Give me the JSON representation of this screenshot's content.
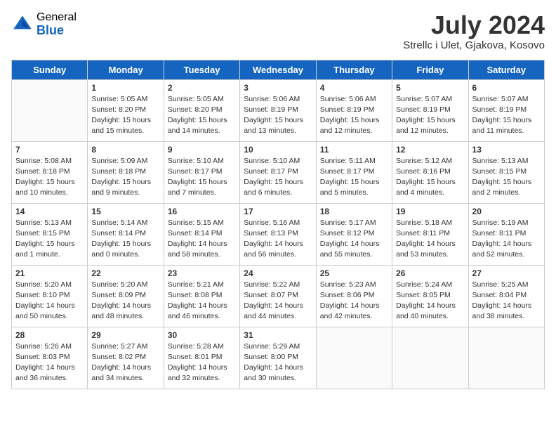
{
  "header": {
    "logo_general": "General",
    "logo_blue": "Blue",
    "month_year": "July 2024",
    "location": "Strellc i Ulet, Gjakova, Kosovo"
  },
  "weekdays": [
    "Sunday",
    "Monday",
    "Tuesday",
    "Wednesday",
    "Thursday",
    "Friday",
    "Saturday"
  ],
  "weeks": [
    [
      {
        "day": "",
        "info": ""
      },
      {
        "day": "1",
        "info": "Sunrise: 5:05 AM\nSunset: 8:20 PM\nDaylight: 15 hours\nand 15 minutes."
      },
      {
        "day": "2",
        "info": "Sunrise: 5:05 AM\nSunset: 8:20 PM\nDaylight: 15 hours\nand 14 minutes."
      },
      {
        "day": "3",
        "info": "Sunrise: 5:06 AM\nSunset: 8:19 PM\nDaylight: 15 hours\nand 13 minutes."
      },
      {
        "day": "4",
        "info": "Sunrise: 5:06 AM\nSunset: 8:19 PM\nDaylight: 15 hours\nand 12 minutes."
      },
      {
        "day": "5",
        "info": "Sunrise: 5:07 AM\nSunset: 8:19 PM\nDaylight: 15 hours\nand 12 minutes."
      },
      {
        "day": "6",
        "info": "Sunrise: 5:07 AM\nSunset: 8:19 PM\nDaylight: 15 hours\nand 11 minutes."
      }
    ],
    [
      {
        "day": "7",
        "info": "Sunrise: 5:08 AM\nSunset: 8:18 PM\nDaylight: 15 hours\nand 10 minutes."
      },
      {
        "day": "8",
        "info": "Sunrise: 5:09 AM\nSunset: 8:18 PM\nDaylight: 15 hours\nand 9 minutes."
      },
      {
        "day": "9",
        "info": "Sunrise: 5:10 AM\nSunset: 8:17 PM\nDaylight: 15 hours\nand 7 minutes."
      },
      {
        "day": "10",
        "info": "Sunrise: 5:10 AM\nSunset: 8:17 PM\nDaylight: 15 hours\nand 6 minutes."
      },
      {
        "day": "11",
        "info": "Sunrise: 5:11 AM\nSunset: 8:17 PM\nDaylight: 15 hours\nand 5 minutes."
      },
      {
        "day": "12",
        "info": "Sunrise: 5:12 AM\nSunset: 8:16 PM\nDaylight: 15 hours\nand 4 minutes."
      },
      {
        "day": "13",
        "info": "Sunrise: 5:13 AM\nSunset: 8:15 PM\nDaylight: 15 hours\nand 2 minutes."
      }
    ],
    [
      {
        "day": "14",
        "info": "Sunrise: 5:13 AM\nSunset: 8:15 PM\nDaylight: 15 hours\nand 1 minute."
      },
      {
        "day": "15",
        "info": "Sunrise: 5:14 AM\nSunset: 8:14 PM\nDaylight: 15 hours\nand 0 minutes."
      },
      {
        "day": "16",
        "info": "Sunrise: 5:15 AM\nSunset: 8:14 PM\nDaylight: 14 hours\nand 58 minutes."
      },
      {
        "day": "17",
        "info": "Sunrise: 5:16 AM\nSunset: 8:13 PM\nDaylight: 14 hours\nand 56 minutes."
      },
      {
        "day": "18",
        "info": "Sunrise: 5:17 AM\nSunset: 8:12 PM\nDaylight: 14 hours\nand 55 minutes."
      },
      {
        "day": "19",
        "info": "Sunrise: 5:18 AM\nSunset: 8:11 PM\nDaylight: 14 hours\nand 53 minutes."
      },
      {
        "day": "20",
        "info": "Sunrise: 5:19 AM\nSunset: 8:11 PM\nDaylight: 14 hours\nand 52 minutes."
      }
    ],
    [
      {
        "day": "21",
        "info": "Sunrise: 5:20 AM\nSunset: 8:10 PM\nDaylight: 14 hours\nand 50 minutes."
      },
      {
        "day": "22",
        "info": "Sunrise: 5:20 AM\nSunset: 8:09 PM\nDaylight: 14 hours\nand 48 minutes."
      },
      {
        "day": "23",
        "info": "Sunrise: 5:21 AM\nSunset: 8:08 PM\nDaylight: 14 hours\nand 46 minutes."
      },
      {
        "day": "24",
        "info": "Sunrise: 5:22 AM\nSunset: 8:07 PM\nDaylight: 14 hours\nand 44 minutes."
      },
      {
        "day": "25",
        "info": "Sunrise: 5:23 AM\nSunset: 8:06 PM\nDaylight: 14 hours\nand 42 minutes."
      },
      {
        "day": "26",
        "info": "Sunrise: 5:24 AM\nSunset: 8:05 PM\nDaylight: 14 hours\nand 40 minutes."
      },
      {
        "day": "27",
        "info": "Sunrise: 5:25 AM\nSunset: 8:04 PM\nDaylight: 14 hours\nand 38 minutes."
      }
    ],
    [
      {
        "day": "28",
        "info": "Sunrise: 5:26 AM\nSunset: 8:03 PM\nDaylight: 14 hours\nand 36 minutes."
      },
      {
        "day": "29",
        "info": "Sunrise: 5:27 AM\nSunset: 8:02 PM\nDaylight: 14 hours\nand 34 minutes."
      },
      {
        "day": "30",
        "info": "Sunrise: 5:28 AM\nSunset: 8:01 PM\nDaylight: 14 hours\nand 32 minutes."
      },
      {
        "day": "31",
        "info": "Sunrise: 5:29 AM\nSunset: 8:00 PM\nDaylight: 14 hours\nand 30 minutes."
      },
      {
        "day": "",
        "info": ""
      },
      {
        "day": "",
        "info": ""
      },
      {
        "day": "",
        "info": ""
      }
    ]
  ]
}
